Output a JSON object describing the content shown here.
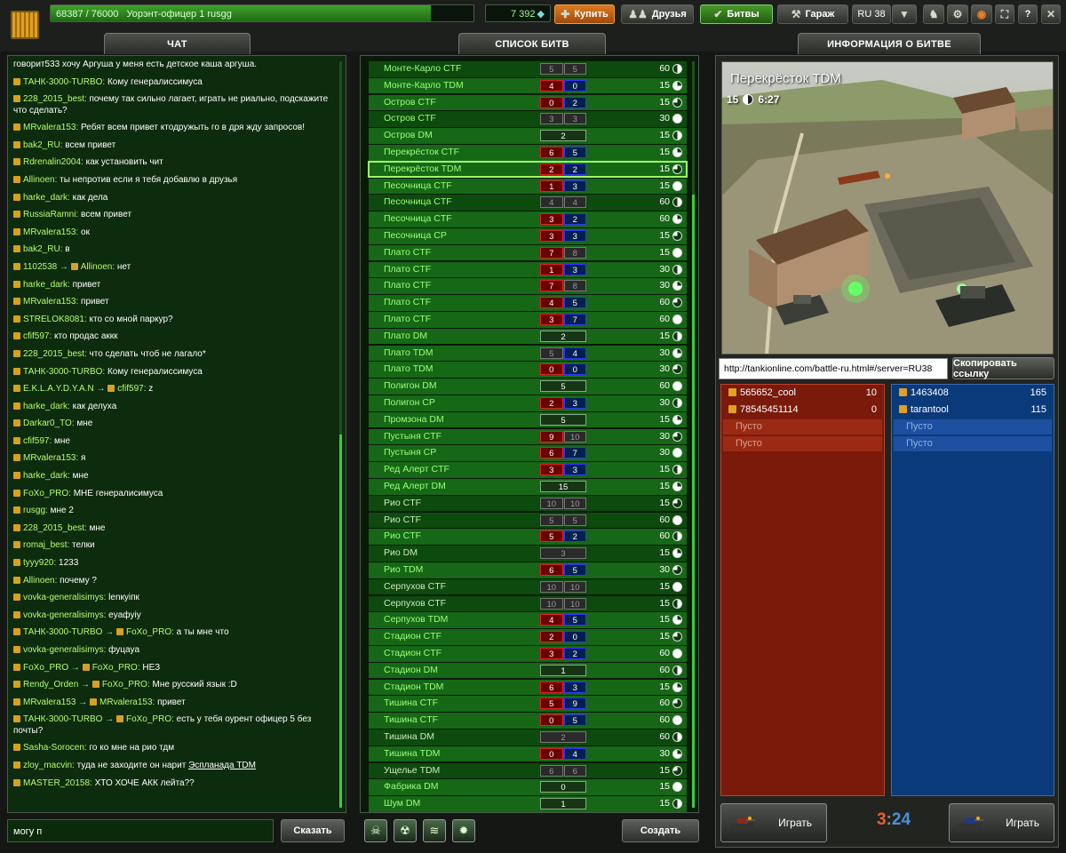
{
  "topbar": {
    "xp_text": "68387 / 76000",
    "rank_text": "Уорэнт-офицер 1 rusgg",
    "xp_fraction": 0.9,
    "crystals": "7 392",
    "buy_label": "Купить",
    "friends_label": "Друзья",
    "battles_label": "Битвы",
    "garage_label": "Гараж",
    "server": "RU 38",
    "help_label": "?"
  },
  "chat": {
    "header": "ЧАТ",
    "input_value": "могу п",
    "say_label": "Сказать",
    "messages": [
      {
        "text": "говорит533 хочу Аргуша у меня есть детское каша аргуша."
      },
      {
        "from": "ТАНК-3000-TURBO:",
        "text": "Кому генералиссимуса"
      },
      {
        "from": "228_2015_best:",
        "text": "почему так сильно лагает, играть не риально, подскажите что сделать?"
      },
      {
        "from": "MRvalera153:",
        "text": "Ребят всем привет ктодружыть го в дря жду запросов!"
      },
      {
        "from": "bak2_RU:",
        "text": "всем привет"
      },
      {
        "from": "Rdrenalin2004:",
        "text": "как установить чит"
      },
      {
        "from": "Allinoen:",
        "text": "ты непротив если я тебя добавлю в друзья"
      },
      {
        "from": "harke_dark:",
        "text": "как дела"
      },
      {
        "from": "RussiaRamni:",
        "text": "всем привет"
      },
      {
        "from": "MRvalera153:",
        "text": "ок"
      },
      {
        "from": "bak2_RU:",
        "text": "в"
      },
      {
        "from": "1102538",
        "to": "Allinoen:",
        "text": "нет"
      },
      {
        "from": "harke_dark:",
        "text": "привет"
      },
      {
        "from": "MRvalera153:",
        "text": "привет"
      },
      {
        "from": "STRELOK8081:",
        "text": "кто со мной паркур?"
      },
      {
        "from": "cfif597:",
        "text": "кто продас аккк"
      },
      {
        "from": "228_2015_best:",
        "text": "что сделать чтоб не лагало*"
      },
      {
        "from": "ТАНК-3000-TURBO:",
        "text": "Кому генералиссимуса"
      },
      {
        "from": "E.K.L.A.Y.D.Y.A.N",
        "to": "cfif597:",
        "text": "z"
      },
      {
        "from": "harke_dark:",
        "text": "как делуха"
      },
      {
        "from": "Darkar0_TO:",
        "text": "мне"
      },
      {
        "from": "cfif597:",
        "text": "мне"
      },
      {
        "from": "MRvalera153:",
        "text": "я"
      },
      {
        "from": "harke_dark:",
        "text": "мне"
      },
      {
        "from": "FoXo_PRO:",
        "text": "МНЕ генералисимуса"
      },
      {
        "from": "rusgg:",
        "text": "мне 2"
      },
      {
        "from": "228_2015_best:",
        "text": "мне"
      },
      {
        "from": "romaj_best:",
        "text": "телки"
      },
      {
        "from": "tyyy920:",
        "text": "1233"
      },
      {
        "from": "Allinoen:",
        "text": "почему ?"
      },
      {
        "from": "vovka-generalisimys:",
        "text": "lenкyiпк"
      },
      {
        "from": "vovka-generalisimys:",
        "text": "eyaфyiy"
      },
      {
        "from": "ТАНК-3000-TURBO",
        "to": "FoXo_PRO:",
        "text": "а ты мне что"
      },
      {
        "from": "vovka-generalisimys:",
        "text": "фуцаyа"
      },
      {
        "from": "FoXo_PRO",
        "to": "FoXo_PRO:",
        "text": "НЕЗ"
      },
      {
        "from": "Rendy_Orden",
        "to": "FoXo_PRO:",
        "text": "Мне русский язык :D"
      },
      {
        "from": "MRvalera153",
        "to": "MRvalera153:",
        "text": "привет"
      },
      {
        "from": "ТАНК-3000-TURBO",
        "to": "FoXo_PRO:",
        "text": "есть у тебя оурент офицер 5 без почты?"
      },
      {
        "from": "Sasha-Sorocen:",
        "text": "го ко мне на рио тдм"
      },
      {
        "from": "zloy_macvin:",
        "text": "туда не заходите он нарит",
        "link": "Эспланада TDM"
      },
      {
        "from": "MASTER_20158:",
        "text": "ХТО ХОЧЕ АКК лейта??"
      }
    ]
  },
  "battle_list": {
    "header": "СПИСОК БИТВ",
    "create_label": "Создать",
    "filter_icons": [
      "ctf-filter-icon",
      "tdm-filter-icon",
      "dm-filter-icon",
      "cp-filter-icon"
    ],
    "battles": [
      {
        "name": "Монте-Карло CTF",
        "red": "5",
        "blue": "5",
        "max": "60",
        "type": "team",
        "empty": true
      },
      {
        "name": "Монте-Карло TDM",
        "red": "4",
        "blue": "0",
        "max": "15",
        "type": "team"
      },
      {
        "name": "Остров CTF",
        "red": "0",
        "blue": "2",
        "max": "15",
        "type": "team"
      },
      {
        "name": "Остров CTF",
        "red": "3",
        "blue": "3",
        "max": "30",
        "type": "team",
        "empty": true
      },
      {
        "name": "Остров DM",
        "dm": "2",
        "max": "15",
        "type": "dm"
      },
      {
        "name": "Перекрёсток CTF",
        "red": "6",
        "blue": "5",
        "max": "15",
        "type": "team"
      },
      {
        "name": "Перекрёсток TDM",
        "red": "2",
        "blue": "2",
        "max": "15",
        "type": "team",
        "selected": true
      },
      {
        "name": "Песочница CTF",
        "red": "1",
        "blue": "3",
        "max": "15",
        "type": "team"
      },
      {
        "name": "Песочница CTF",
        "red": "4",
        "blue": "4",
        "max": "60",
        "type": "team",
        "empty": true
      },
      {
        "name": "Песочница CTF",
        "red": "3",
        "blue": "2",
        "max": "60",
        "type": "team"
      },
      {
        "name": "Песочница CP",
        "red": "3",
        "blue": "3",
        "max": "15",
        "type": "team"
      },
      {
        "name": "Плато CTF",
        "red": "7",
        "blue": "8",
        "max": "15",
        "type": "team",
        "blueEmpty": true
      },
      {
        "name": "Плато CTF",
        "red": "1",
        "blue": "3",
        "max": "30",
        "type": "team"
      },
      {
        "name": "Плато CTF",
        "red": "7",
        "blue": "8",
        "max": "30",
        "type": "team",
        "blueEmpty": true
      },
      {
        "name": "Плато CTF",
        "red": "4",
        "blue": "5",
        "max": "60",
        "type": "team"
      },
      {
        "name": "Плато CTF",
        "red": "3",
        "blue": "7",
        "max": "60",
        "type": "team"
      },
      {
        "name": "Плато DM",
        "dm": "2",
        "max": "15",
        "type": "dm"
      },
      {
        "name": "Плато TDM",
        "red": "5",
        "blue": "4",
        "max": "30",
        "type": "team",
        "redEmpty": true
      },
      {
        "name": "Плато TDM",
        "red": "0",
        "blue": "0",
        "max": "30",
        "type": "team"
      },
      {
        "name": "Полигон DM",
        "dm": "5",
        "max": "60",
        "type": "dm"
      },
      {
        "name": "Полигон CP",
        "red": "2",
        "blue": "3",
        "max": "30",
        "type": "team"
      },
      {
        "name": "Промзона DM",
        "dm": "5",
        "max": "15",
        "type": "dm"
      },
      {
        "name": "Пустыня CTF",
        "red": "9",
        "blue": "10",
        "max": "30",
        "type": "team",
        "blueEmpty": true
      },
      {
        "name": "Пустыня CP",
        "red": "6",
        "blue": "7",
        "max": "30",
        "type": "team"
      },
      {
        "name": "Ред Алерт CTF",
        "red": "3",
        "blue": "3",
        "max": "15",
        "type": "team"
      },
      {
        "name": "Ред Алерт DM",
        "dm": "15",
        "max": "15",
        "type": "dm"
      },
      {
        "name": "Рио CTF",
        "red": "10",
        "blue": "10",
        "max": "15",
        "type": "team",
        "empty": true,
        "white": true
      },
      {
        "name": "Рио CTF",
        "red": "5",
        "blue": "5",
        "max": "60",
        "type": "team",
        "empty": true,
        "white": true
      },
      {
        "name": "Рио CTF",
        "red": "5",
        "blue": "2",
        "max": "60",
        "type": "team"
      },
      {
        "name": "Рио DM",
        "dm": "3",
        "max": "15",
        "type": "dm",
        "empty": true,
        "white": true
      },
      {
        "name": "Рио TDM",
        "red": "6",
        "blue": "5",
        "max": "30",
        "type": "team"
      },
      {
        "name": "Серпухов CTF",
        "red": "10",
        "blue": "10",
        "max": "15",
        "type": "team",
        "empty": true,
        "white": true
      },
      {
        "name": "Серпухов CTF",
        "red": "10",
        "blue": "10",
        "max": "15",
        "type": "team",
        "empty": true,
        "white": true
      },
      {
        "name": "Серпухов TDM",
        "red": "4",
        "blue": "5",
        "max": "15",
        "type": "team"
      },
      {
        "name": "Стадион CTF",
        "red": "2",
        "blue": "0",
        "max": "15",
        "type": "team"
      },
      {
        "name": "Стадион CTF",
        "red": "3",
        "blue": "2",
        "max": "60",
        "type": "team"
      },
      {
        "name": "Стадион DM",
        "dm": "1",
        "max": "60",
        "type": "dm"
      },
      {
        "name": "Стадион TDM",
        "red": "6",
        "blue": "3",
        "max": "15",
        "type": "team"
      },
      {
        "name": "Тишина CTF",
        "red": "5",
        "blue": "9",
        "max": "60",
        "type": "team"
      },
      {
        "name": "Тишина CTF",
        "red": "0",
        "blue": "5",
        "max": "60",
        "type": "team"
      },
      {
        "name": "Тишина DM",
        "dm": "2",
        "max": "60",
        "type": "dm",
        "empty": true,
        "white": true
      },
      {
        "name": "Тишина TDM",
        "red": "0",
        "blue": "4",
        "max": "30",
        "type": "team"
      },
      {
        "name": "Ущелье TDM",
        "red": "6",
        "blue": "6",
        "max": "15",
        "type": "team",
        "empty": true,
        "white": true
      },
      {
        "name": "Фабрика DM",
        "dm": "0",
        "max": "15",
        "type": "dm"
      },
      {
        "name": "Шум DM",
        "dm": "1",
        "max": "15",
        "type": "dm"
      }
    ]
  },
  "battle_info": {
    "header": "ИНФОРМАЦИЯ О БИТВЕ",
    "title": "Перекрёсток TDM",
    "limit": "15",
    "time": "6:27",
    "url": "http://tankionline.com/battle-ru.html#/server=RU38",
    "copy_label": "Скопировать ссылку",
    "red_team": [
      {
        "name": "565652_cool",
        "score": "10"
      },
      {
        "name": "78545451114",
        "score": "0"
      },
      {
        "name": "Пусто",
        "empty": true
      },
      {
        "name": "Пусто",
        "empty": true
      }
    ],
    "blue_team": [
      {
        "name": "1463408",
        "score": "165"
      },
      {
        "name": "tarantool",
        "score": "115"
      },
      {
        "name": "Пусто",
        "empty": true
      },
      {
        "name": "Пусто",
        "empty": true
      }
    ],
    "play_label": "Играть",
    "score_red": "3",
    "score_sep": ":",
    "score_blue": "24"
  }
}
